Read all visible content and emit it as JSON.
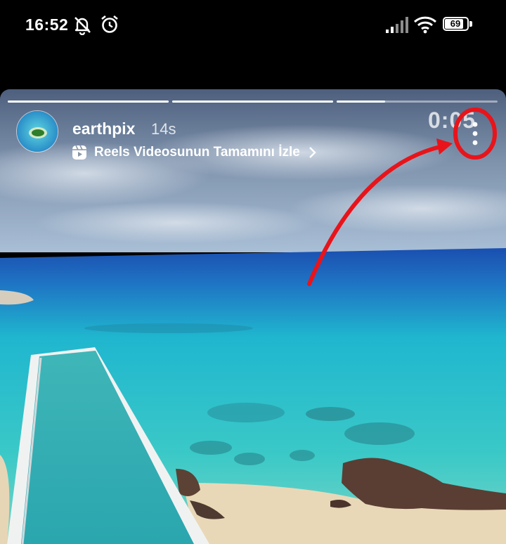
{
  "status_bar": {
    "time": "16:52",
    "battery": "69"
  },
  "story": {
    "username": "earthpix",
    "age": "14s",
    "reels_link_label": "Reels Videosunun Tamamını İzle",
    "timer": "0:05",
    "progress": [
      1.0,
      1.0,
      0.3
    ]
  },
  "icons": {
    "status": [
      "mute-icon",
      "alarm-icon",
      "signal-icon",
      "wifi-icon",
      "battery-icon"
    ],
    "story": [
      "reels-icon",
      "chevron-right-icon",
      "more-options-icon"
    ]
  },
  "colors": {
    "annotation_red": "#e8141a",
    "sea": "#2ec4c9",
    "deep_sea": "#1a4fb0"
  }
}
